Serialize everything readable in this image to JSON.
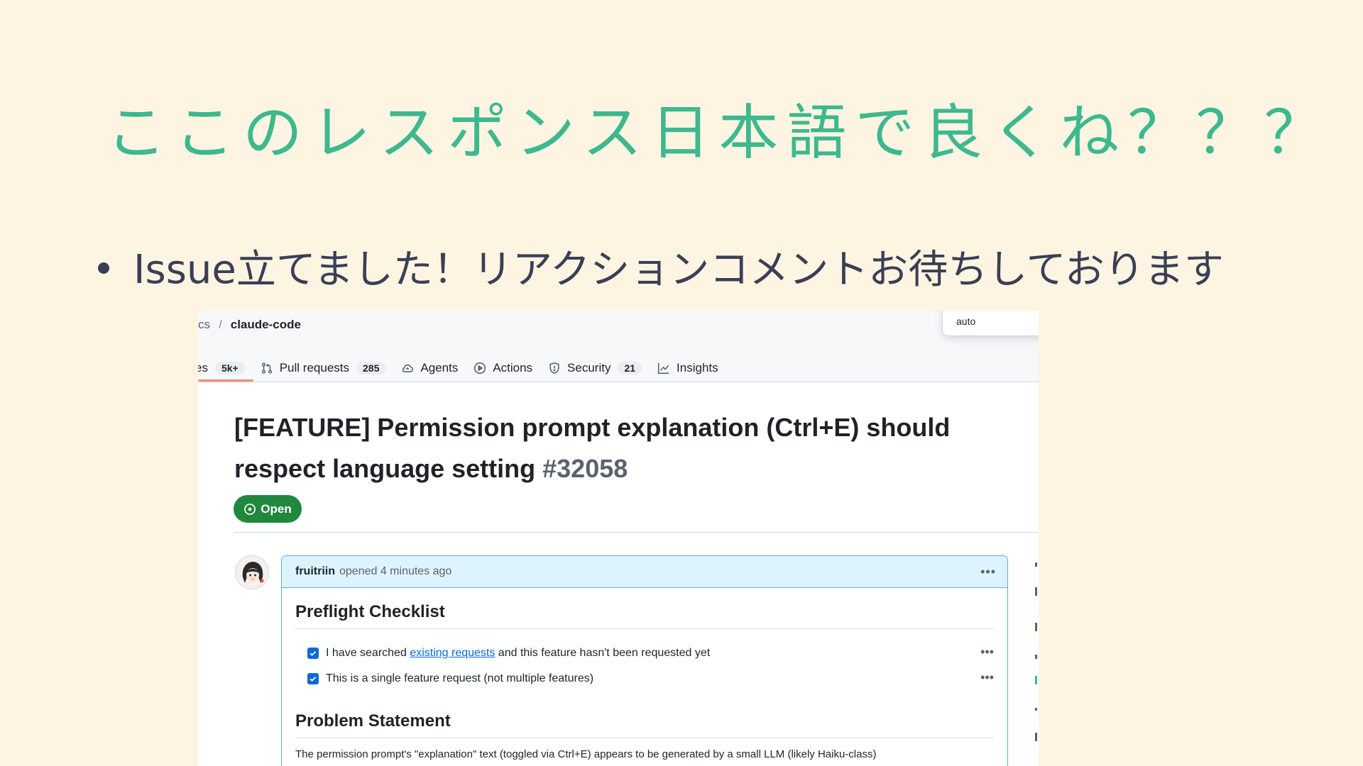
{
  "slide": {
    "title": "ここのレスポンス日本語で良くね？？？",
    "bullet": "Issue立てました！リアクションコメントお待ちしております"
  },
  "screenshot": {
    "breadcrumb": {
      "owner_fragment": "cs",
      "separator": "/",
      "repo": "claude-code"
    },
    "popup": {
      "value": "auto"
    },
    "tabs": [
      {
        "label": "es",
        "counter": "5k+",
        "icon": "issue-icon"
      },
      {
        "label": "Pull requests",
        "counter": "285",
        "icon": "pull-request-icon"
      },
      {
        "label": "Agents",
        "counter": "",
        "icon": "agents-icon"
      },
      {
        "label": "Actions",
        "counter": "",
        "icon": "play-icon"
      },
      {
        "label": "Security",
        "counter": "21",
        "icon": "shield-icon"
      },
      {
        "label": "Insights",
        "counter": "",
        "icon": "graph-icon"
      }
    ],
    "issue": {
      "title": "[FEATURE] Permission prompt explanation (Ctrl+E) should respect language setting",
      "number": "#32058",
      "state": "Open"
    },
    "comment": {
      "author": "fruitriin",
      "meta": "opened 4 minutes ago",
      "heading_1": "Preflight Checklist",
      "tasks": [
        {
          "prefix": "I have searched ",
          "link": "existing requests",
          "suffix": " and this feature hasn't been requested yet",
          "checked": true
        },
        {
          "prefix": "This is a single feature request (not multiple features)",
          "link": "",
          "suffix": "",
          "checked": true
        }
      ],
      "heading_2": "Problem Statement",
      "paragraph": "The permission prompt's \"explanation\" text (toggled via Ctrl+E) appears to be generated by a small LLM (likely Haiku-class)"
    }
  },
  "colors": {
    "background": "#fdf5e2",
    "title": "#3db88f",
    "text": "#3a3f55",
    "open_badge": "#1f883d",
    "link": "#0969da"
  }
}
